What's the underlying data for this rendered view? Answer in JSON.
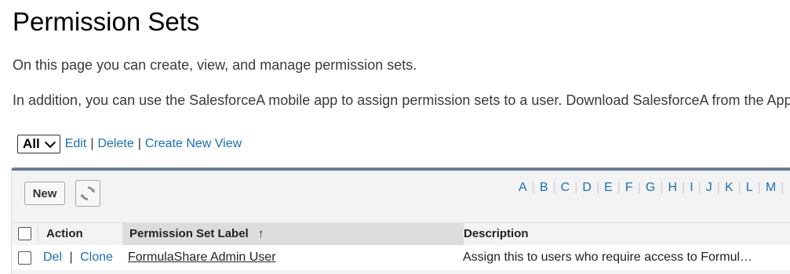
{
  "page": {
    "title": "Permission Sets",
    "intro": "On this page you can create, view, and manage permission sets.",
    "addition": "In addition, you can use the SalesforceA mobile app to assign permission sets to a user. Download SalesforceA from the App Store or Google Play."
  },
  "view": {
    "selected": "All",
    "edit_label": "Edit",
    "delete_label": "Delete",
    "create_label": "Create New View",
    "separator": "|"
  },
  "toolbar": {
    "new_label": "New",
    "refresh_icon": "refresh-icon"
  },
  "alphabet": [
    "A",
    "B",
    "C",
    "D",
    "E",
    "F",
    "G",
    "H",
    "I",
    "J",
    "K",
    "L",
    "M"
  ],
  "table": {
    "headers": {
      "action": "Action",
      "label": "Permission Set Label",
      "sort_indicator": "↑",
      "description": "Description"
    },
    "rows": [
      {
        "del": "Del",
        "clone": "Clone",
        "label": "FormulaShare Admin User",
        "description": "Assign this to users who require access to Formul…"
      }
    ]
  },
  "colors": {
    "link": "#1a6fb3",
    "panel_border": "#6b7d95",
    "panel_bg": "#f3f3f3",
    "sorted_header_bg": "#dcdcdc"
  }
}
